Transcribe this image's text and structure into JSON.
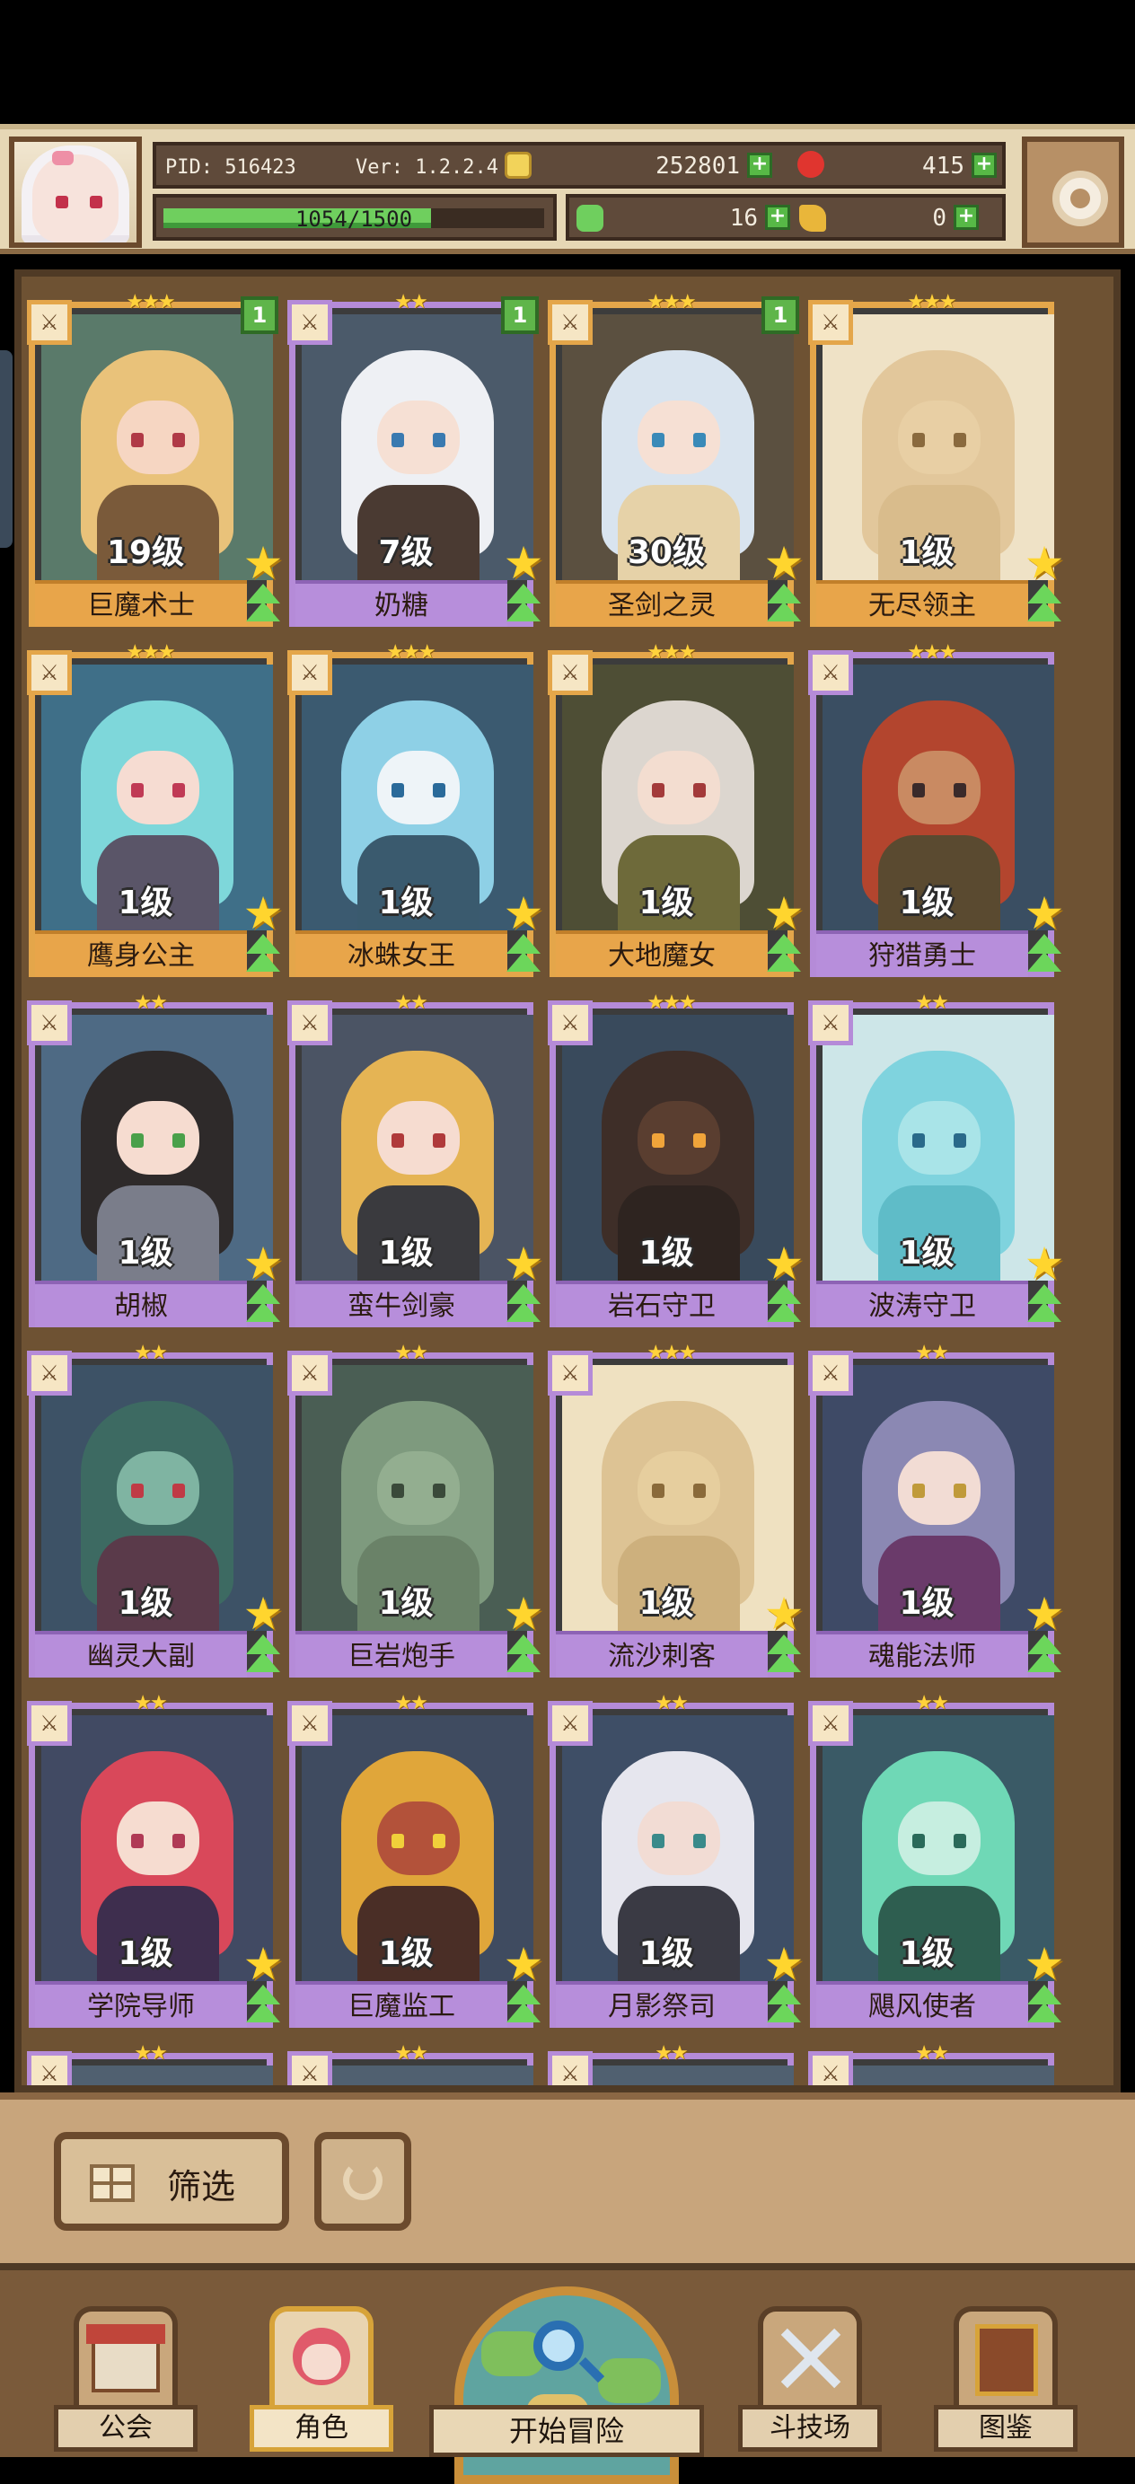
{
  "header": {
    "pid": "PID: 516423",
    "version": "Ver: 1.2.2.4",
    "gold": "252801",
    "gems": "415",
    "xp_text": "1054/1500",
    "xp_fraction": 0.703,
    "clover": "16",
    "keys": "0"
  },
  "cards": [
    {
      "level": "19级",
      "name": "巨魔术士",
      "stars": "★★★",
      "count": "1",
      "plate": "gold",
      "hair": "#e9c27a",
      "skin": "#f6d6c2",
      "eye": "#b03a46",
      "body": "#7a5a3a",
      "bg": "#5a7a6a"
    },
    {
      "level": "7级",
      "name": "奶糖",
      "stars": "★★",
      "count": "1",
      "plate": "purple",
      "hair": "#eef0f4",
      "skin": "#f6e0d4",
      "eye": "#3a7ab0",
      "body": "#4a3a32",
      "bg": "#4b5a6a"
    },
    {
      "level": "30级",
      "name": "圣剑之灵",
      "stars": "★★★",
      "count": "1",
      "plate": "gold",
      "hair": "#d9e4ef",
      "skin": "#f6e0d4",
      "eye": "#3a8ab8",
      "body": "#e6d2a8",
      "bg": "#5b5040"
    },
    {
      "level": "1级",
      "name": "无尽领主",
      "stars": "★★★",
      "count": "",
      "plate": "gold",
      "hair": "#e2c79b",
      "skin": "#e8cfa4",
      "eye": "#8a6a3e",
      "body": "#d9bc8c",
      "bg": "#efe2c6"
    },
    {
      "level": "1级",
      "name": "鹰身公主",
      "stars": "★★★",
      "count": "",
      "plate": "gold",
      "hair": "#7ed7da",
      "skin": "#f6dcd2",
      "eye": "#c03a55",
      "body": "#5a5568",
      "bg": "#3f6f88"
    },
    {
      "level": "1级",
      "name": "冰蛛女王",
      "stars": "★★★",
      "count": "",
      "plate": "gold",
      "hair": "#8ed0e6",
      "skin": "#eef4f8",
      "eye": "#2a6a9a",
      "body": "#3a5a6e",
      "bg": "#3b5a70"
    },
    {
      "level": "1级",
      "name": "大地魔女",
      "stars": "★★★",
      "count": "",
      "plate": "gold",
      "hair": "#dcd6cf",
      "skin": "#f3ddd0",
      "eye": "#a33a3a",
      "body": "#6e6a3a",
      "bg": "#4e4e35"
    },
    {
      "level": "1级",
      "name": "狩猎勇士",
      "stars": "★★★",
      "count": "",
      "plate": "purple",
      "hair": "#b3452e",
      "skin": "#c98a62",
      "eye": "#3a2a2a",
      "body": "#5a4a30",
      "bg": "#3a4e62"
    },
    {
      "level": "1级",
      "name": "胡椒",
      "stars": "★★",
      "count": "",
      "plate": "purple",
      "hair": "#2e2a2a",
      "skin": "#f6dcd0",
      "eye": "#4aa04a",
      "body": "#7a7d8a",
      "bg": "#4e6a84"
    },
    {
      "level": "1级",
      "name": "蛮牛剑豪",
      "stars": "★★",
      "count": "",
      "plate": "purple",
      "hair": "#e5b454",
      "skin": "#f6dcd0",
      "eye": "#b03a3a",
      "body": "#3a3a3e",
      "bg": "#4b5464"
    },
    {
      "level": "1级",
      "name": "岩石守卫",
      "stars": "★★★",
      "count": "",
      "plate": "purple",
      "hair": "#3e2e28",
      "skin": "#5a3e30",
      "eye": "#f0a43a",
      "body": "#2e2420",
      "bg": "#394a5c"
    },
    {
      "level": "1级",
      "name": "波涛守卫",
      "stars": "★★",
      "count": "",
      "plate": "purple",
      "hair": "#7fd3de",
      "skin": "#a9e4e8",
      "eye": "#2a6a8a",
      "body": "#5fbcc8",
      "bg": "#cde6e8"
    },
    {
      "level": "1级",
      "name": "幽灵大副",
      "stars": "★★",
      "count": "",
      "plate": "purple",
      "hair": "#3d6a62",
      "skin": "#7fb4a2",
      "eye": "#c03a45",
      "body": "#5a3a4a",
      "bg": "#3d5266"
    },
    {
      "level": "1级",
      "name": "巨岩炮手",
      "stars": "★★",
      "count": "",
      "plate": "purple",
      "hair": "#7e9a7e",
      "skin": "#93ae90",
      "eye": "#3a4a3a",
      "body": "#6a8268",
      "bg": "#4a5e54"
    },
    {
      "level": "1级",
      "name": "流沙刺客",
      "stars": "★★★",
      "count": "",
      "plate": "purple",
      "hair": "#ddc394",
      "skin": "#e6ce9e",
      "eye": "#8a6a3a",
      "body": "#cdb07d",
      "bg": "#efe1c1"
    },
    {
      "level": "1级",
      "name": "魂能法师",
      "stars": "★★",
      "count": "",
      "plate": "purple",
      "hair": "#8b88b3",
      "skin": "#f2dcd4",
      "eye": "#c09a3a",
      "body": "#6a3a6a",
      "bg": "#3e4a66"
    },
    {
      "level": "1级",
      "name": "学院导师",
      "stars": "★★",
      "count": "",
      "plate": "purple",
      "hair": "#d9485a",
      "skin": "#f6dcd0",
      "eye": "#b03a55",
      "body": "#3e2e4e",
      "bg": "#414a63"
    },
    {
      "level": "1级",
      "name": "巨魔监工",
      "stars": "★★",
      "count": "",
      "plate": "purple",
      "hair": "#e0a63a",
      "skin": "#b3523a",
      "eye": "#f0d03a",
      "body": "#4a2e26",
      "bg": "#3f4b60"
    },
    {
      "level": "1级",
      "name": "月影祭司",
      "stars": "★★",
      "count": "",
      "plate": "purple",
      "hair": "#e6e6ee",
      "skin": "#f2dcd4",
      "eye": "#3a8a8a",
      "body": "#3a3a44",
      "bg": "#3e4e66"
    },
    {
      "level": "1级",
      "name": "飓风使者",
      "stars": "★★",
      "count": "",
      "plate": "purple",
      "hair": "#6fd8b6",
      "skin": "#c6eee0",
      "eye": "#2a6a5a",
      "body": "#2e5e50",
      "bg": "#3a5a66"
    },
    {
      "level": "",
      "name": "",
      "stars": "★★",
      "count": "",
      "plate": "purple",
      "hair": "#e6d2a8",
      "skin": "#f6dcd0",
      "eye": "#333",
      "body": "#5a4a3a",
      "bg": "#506070"
    },
    {
      "level": "",
      "name": "",
      "stars": "★★",
      "count": "",
      "plate": "purple",
      "hair": "#8a4a3a",
      "skin": "#f6dcd0",
      "eye": "#333",
      "body": "#5a4a3a",
      "bg": "#506070"
    },
    {
      "level": "",
      "name": "",
      "stars": "★★",
      "count": "",
      "plate": "purple",
      "hair": "#3a5a7a",
      "skin": "#f6dcd0",
      "eye": "#333",
      "body": "#5a4a3a",
      "bg": "#506070"
    },
    {
      "level": "",
      "name": "",
      "stars": "★★",
      "count": "",
      "plate": "purple",
      "hair": "#e6e0d8",
      "skin": "#f6dcd0",
      "eye": "#333",
      "body": "#5a4a3a",
      "bg": "#506070"
    }
  ],
  "filter": {
    "label": "筛选"
  },
  "nav": {
    "guild": "公会",
    "character": "角色",
    "adventure": "开始冒险",
    "arena": "斗技场",
    "codex": "图鉴"
  },
  "colors": {
    "gold_frame": "#e4a64a",
    "purple_frame": "#b58bd8",
    "plus_green": "#57b946"
  }
}
